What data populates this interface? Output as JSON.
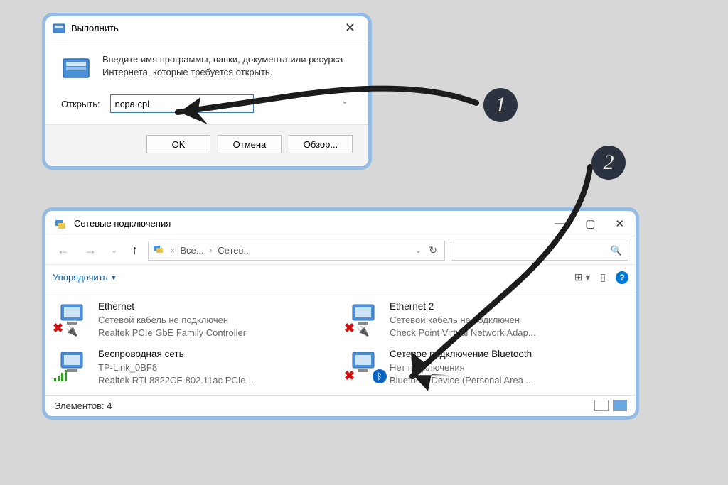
{
  "run_dialog": {
    "title": "Выполнить",
    "body_text": "Введите имя программы, папки, документа или ресурса Интернета, которые требуется открыть.",
    "input_label": "Открыть:",
    "input_value": "ncpa.cpl",
    "buttons": {
      "ok": "OK",
      "cancel": "Отмена",
      "browse": "Обзор..."
    }
  },
  "explorer": {
    "title": "Сетевые подключения",
    "breadcrumb": {
      "segment1": "Все...",
      "segment2": "Сетев..."
    },
    "toolbar": {
      "organize": "Упорядочить"
    },
    "connections": [
      {
        "name": "Ethernet",
        "status": "Сетевой кабель не подключен",
        "driver": "Realtek PCIe GbE Family Controller"
      },
      {
        "name": "Ethernet 2",
        "status": "Сетевой кабель не подключен",
        "driver": "Check Point Virtual Network Adap..."
      },
      {
        "name": "Беспроводная сеть",
        "status": "TP-Link_0BF8",
        "driver": "Realtek RTL8822CE 802.11ac PCIe ..."
      },
      {
        "name": "Сетевое подключение Bluetooth",
        "status": "Нет подключения",
        "driver": "Bluetooth Device (Personal Area ..."
      }
    ],
    "status_bar": {
      "items_label": "Элементов:",
      "items_count": "4"
    }
  },
  "annotations": {
    "step1": "1",
    "step2": "2"
  }
}
